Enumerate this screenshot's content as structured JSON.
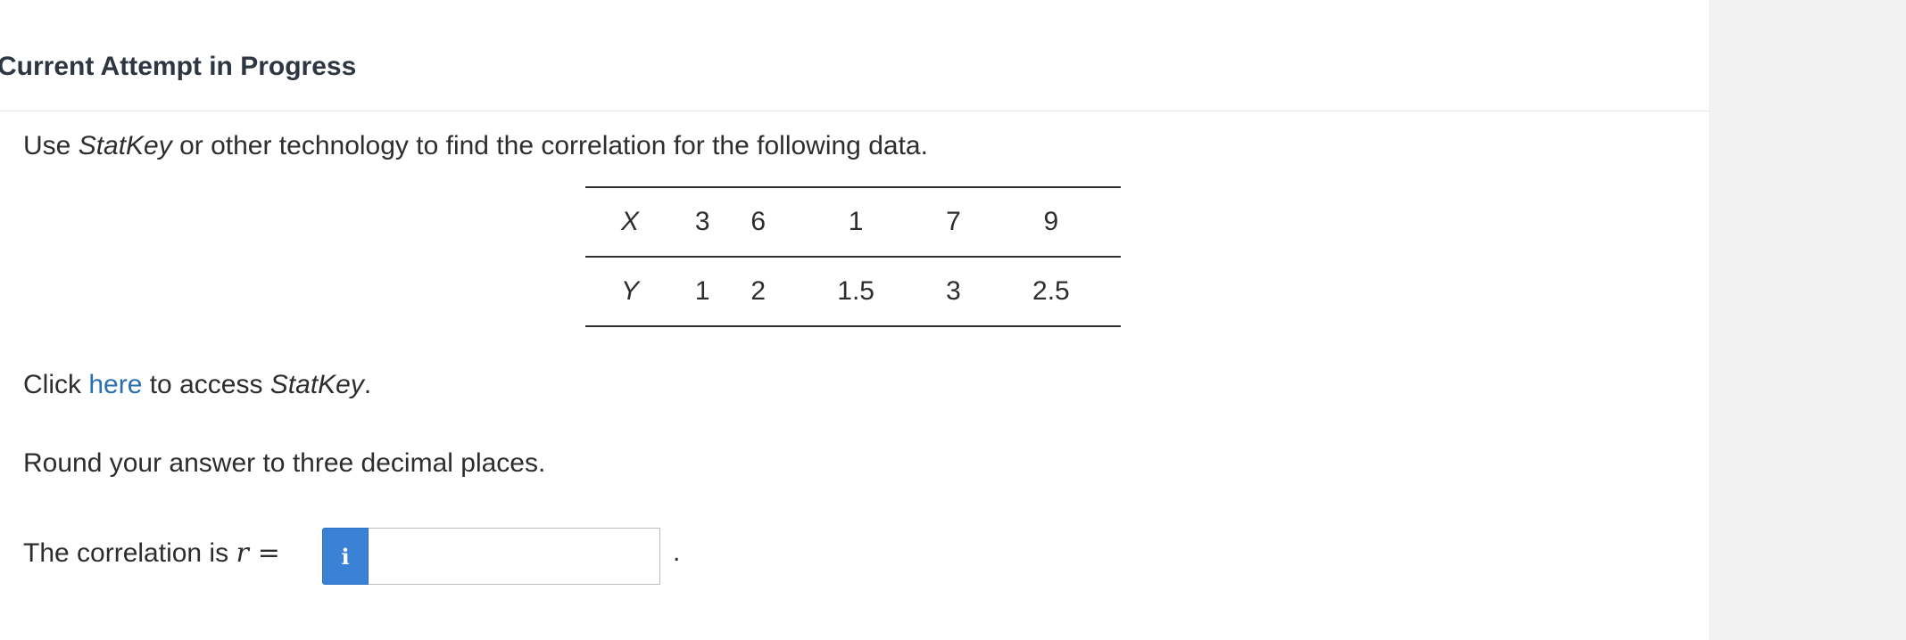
{
  "header": {
    "title": "Current Attempt in Progress"
  },
  "question": {
    "instruction_pre": "Use ",
    "instruction_italic": "StatKey",
    "instruction_post": " or other technology to find the correlation for the following data.",
    "table": {
      "rows": [
        {
          "label": "X",
          "values": [
            "3",
            "6",
            "1",
            "7",
            "9"
          ]
        },
        {
          "label": "Y",
          "values": [
            "1",
            "2",
            "1.5",
            "3",
            "2.5"
          ]
        }
      ]
    },
    "access_pre": "Click ",
    "access_link": "here",
    "access_mid": " to access ",
    "access_italic": "StatKey",
    "access_post": ".",
    "round_text": "Round your answer to three decimal places.",
    "answer_label": "The correlation is ",
    "answer_var": "r",
    "answer_eq": "=",
    "info_icon": "i",
    "answer_value": "",
    "answer_suffix": "."
  }
}
